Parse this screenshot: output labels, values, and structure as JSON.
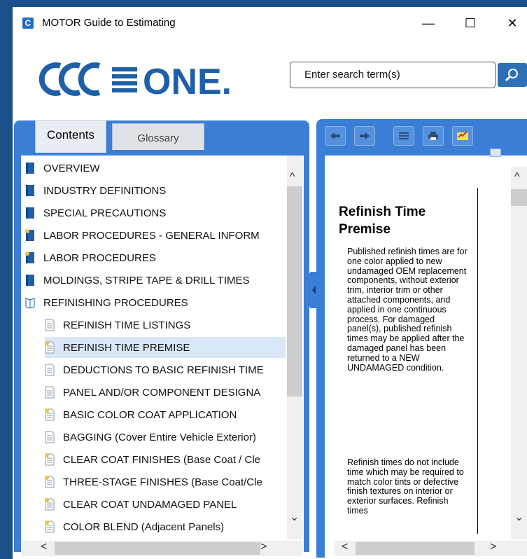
{
  "window": {
    "title": "MOTOR Guide to Estimating",
    "app_icon": "C",
    "minimize": "—",
    "maximize": "☐",
    "close": "✕"
  },
  "search": {
    "placeholder": "Enter search term(s)"
  },
  "tabs": {
    "contents": "Contents",
    "glossary": "Glossary"
  },
  "toolbar": {
    "icons": [
      "back-arrow-icon",
      "forward-arrow-icon",
      "list-icon",
      "print-icon",
      "highlight-icon"
    ]
  },
  "tree": {
    "items": [
      {
        "label": "OVERVIEW",
        "icon": "closed-book-icon"
      },
      {
        "label": "INDUSTRY DEFINITIONS",
        "icon": "closed-book-icon"
      },
      {
        "label": "SPECIAL PRECAUTIONS",
        "icon": "closed-book-icon"
      },
      {
        "label": "LABOR PROCEDURES - GENERAL INFORM",
        "icon": "book-note-icon"
      },
      {
        "label": "LABOR PROCEDURES",
        "icon": "book-note-icon"
      },
      {
        "label": "MOLDINGS, STRIPE TAPE & DRILL TIMES",
        "icon": "closed-book-icon"
      },
      {
        "label": "REFINISHING PROCEDURES",
        "icon": "open-book-icon"
      },
      {
        "label": "REFINISH TIME LISTINGS",
        "icon": "page-icon"
      },
      {
        "label": "REFINISH TIME PREMISE",
        "icon": "page-note-icon"
      },
      {
        "label": "DEDUCTIONS TO BASIC REFINISH TIME",
        "icon": "page-icon"
      },
      {
        "label": "PANEL AND/OR COMPONENT DESIGNA",
        "icon": "page-icon"
      },
      {
        "label": "BASIC COLOR COAT APPLICATION",
        "icon": "page-note-icon"
      },
      {
        "label": "BAGGING (Cover Entire Vehicle Exterior)",
        "icon": "page-icon"
      },
      {
        "label": "CLEAR COAT FINISHES (Base Coat / Cle",
        "icon": "page-note-icon"
      },
      {
        "label": "THREE-STAGE FINISHES (Base Coat/Cle",
        "icon": "page-note-icon"
      },
      {
        "label": "CLEAR COAT UNDAMAGED PANEL",
        "icon": "page-note-icon"
      },
      {
        "label": "COLOR BLEND (Adjacent Panels)",
        "icon": "page-note-icon"
      }
    ]
  },
  "document": {
    "title": "Refinish Time Premise",
    "paragraphs": [
      "Published refinish times are for one color applied to new undamaged OEM replacement components, without exterior trim, interior trim or other attached components, and applied in one continuous process. For damaged panel(s), published refinish times may be applied after the damaged panel has been returned to a NEW UNDAMAGED condition.",
      "Refinish times do not include time which may be required to match color tints or defective finish textures on interior or exterior surfaces. Refinish times"
    ]
  },
  "colors": {
    "frame_blue": "#3a7ed6",
    "desktop_blue": "#1b4f8a",
    "selected_row": "#d9e7f6",
    "logo_blue": "#1f5fa8"
  }
}
